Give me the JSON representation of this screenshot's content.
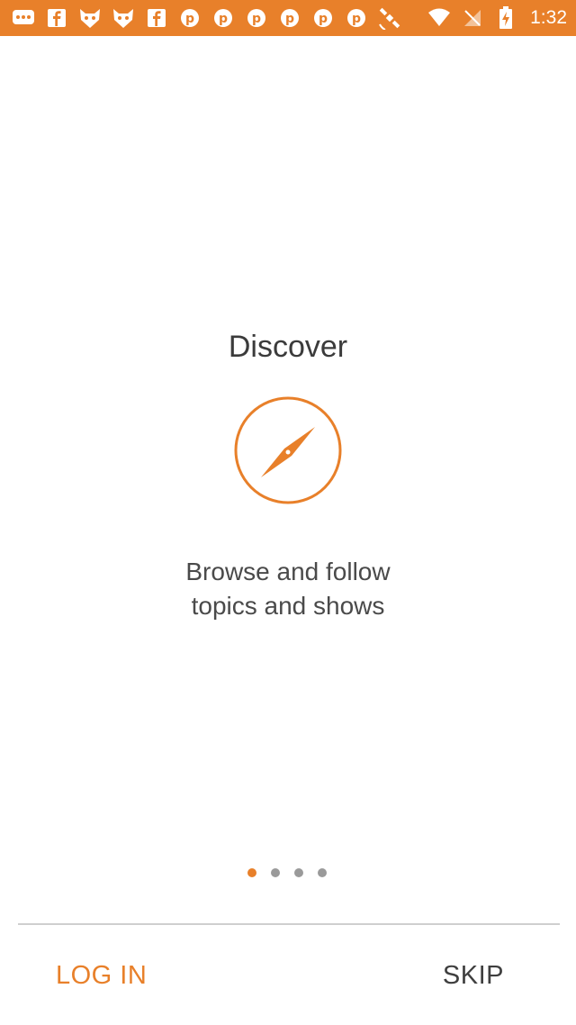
{
  "status_bar": {
    "time": "1:32",
    "left_icons": [
      {
        "name": "message-icon"
      },
      {
        "name": "facebook-icon"
      },
      {
        "name": "cat-mask-icon"
      },
      {
        "name": "cat-mask-icon"
      },
      {
        "name": "facebook-icon"
      },
      {
        "name": "pinterest-icon"
      },
      {
        "name": "pinterest-icon"
      },
      {
        "name": "pinterest-icon"
      },
      {
        "name": "pinterest-icon"
      },
      {
        "name": "pinterest-icon"
      },
      {
        "name": "pinterest-icon"
      },
      {
        "name": "satellite-icon"
      }
    ],
    "right_icons": [
      {
        "name": "wifi-icon"
      },
      {
        "name": "no-signal-icon"
      },
      {
        "name": "battery-charging-icon"
      }
    ]
  },
  "onboarding": {
    "title": "Discover",
    "icon": "compass-icon",
    "description_line1": "Browse and follow",
    "description_line2": "topics and shows",
    "page_count": 4,
    "current_page": 1
  },
  "footer": {
    "login_label": "LOG IN",
    "skip_label": "SKIP"
  },
  "colors": {
    "accent": "#e8802a",
    "text_primary": "#3b3b3b",
    "dot_inactive": "#9a9a9a"
  }
}
